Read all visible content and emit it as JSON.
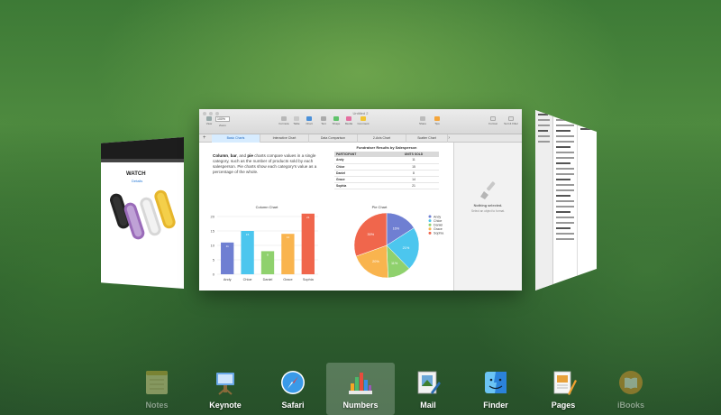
{
  "app_switcher": {
    "window_title": "Untitled 2",
    "toolbar": {
      "zoom_value": "100%",
      "left_items": [
        "View",
        "Zoom"
      ],
      "center_items": [
        "Formula",
        "Table",
        "Chart",
        "Text",
        "Shape",
        "Media",
        "Comment"
      ],
      "right_items": [
        "Share",
        "Tips"
      ],
      "sidebar_items": [
        "Format",
        "Sort & Filter"
      ]
    },
    "tabs": [
      "Basic Charts",
      "Interactive Chart",
      "Data Comparison",
      "2-Axis Chart",
      "Scatter Chart"
    ],
    "active_tab": "Basic Charts",
    "intro_bold_1": "Column",
    "intro_sep_1": ", ",
    "intro_bold_2": "bar",
    "intro_sep_2": ", and ",
    "intro_bold_3": "pie",
    "intro_rest": " charts compare values in a single category, such as the number of products sold by each salesperson. Pie charts show each category's value as a percentage of the whole.",
    "table": {
      "title": "Fundraiser Results by Salesperson",
      "headers": [
        "PARTICIPANT",
        "UNITS SOLD"
      ],
      "rows": [
        {
          "name": "Andy",
          "units": "11"
        },
        {
          "name": "Chloe",
          "units": "15"
        },
        {
          "name": "Daniel",
          "units": "8"
        },
        {
          "name": "Grace",
          "units": "14"
        },
        {
          "name": "Sophia",
          "units": "21"
        }
      ]
    },
    "sidebar": {
      "title": "Nothing selected.",
      "subtitle": "Select an object to format."
    },
    "left_window": {
      "title": "WATCH",
      "subtitle": "Details"
    }
  },
  "chart_data": [
    {
      "type": "bar",
      "title": "Column Chart",
      "categories": [
        "Andy",
        "Chloe",
        "Daniel",
        "Grace",
        "Sophia"
      ],
      "values": [
        11,
        15,
        8,
        14,
        21
      ],
      "ylim": [
        0,
        20
      ],
      "yticks": [
        "20",
        "15",
        "10",
        "5",
        "0"
      ],
      "colors": [
        "#6f7fd2",
        "#4cc6ee",
        "#8fd16d",
        "#f9b44e",
        "#f0664c"
      ]
    },
    {
      "type": "pie",
      "title": "Pie Chart",
      "categories": [
        "Andy",
        "Chloe",
        "Daniel",
        "Grace",
        "Sophia"
      ],
      "values": [
        11,
        15,
        8,
        14,
        21
      ],
      "labels": [
        "16%",
        "21%",
        "11%",
        "20%",
        "30%"
      ],
      "colors": [
        "#6f7fd2",
        "#4cc6ee",
        "#8fd16d",
        "#f9b44e",
        "#f0664c"
      ],
      "legend": "right"
    }
  ],
  "dock": {
    "items": [
      {
        "label": "Notes",
        "icon": "notes-icon"
      },
      {
        "label": "Keynote",
        "icon": "keynote-icon"
      },
      {
        "label": "Safari",
        "icon": "safari-icon"
      },
      {
        "label": "Numbers",
        "icon": "numbers-icon"
      },
      {
        "label": "Mail",
        "icon": "mail-icon"
      },
      {
        "label": "Finder",
        "icon": "finder-icon"
      },
      {
        "label": "Pages",
        "icon": "pages-icon"
      },
      {
        "label": "iBooks",
        "icon": "ibooks-icon"
      }
    ],
    "active": "Numbers"
  }
}
